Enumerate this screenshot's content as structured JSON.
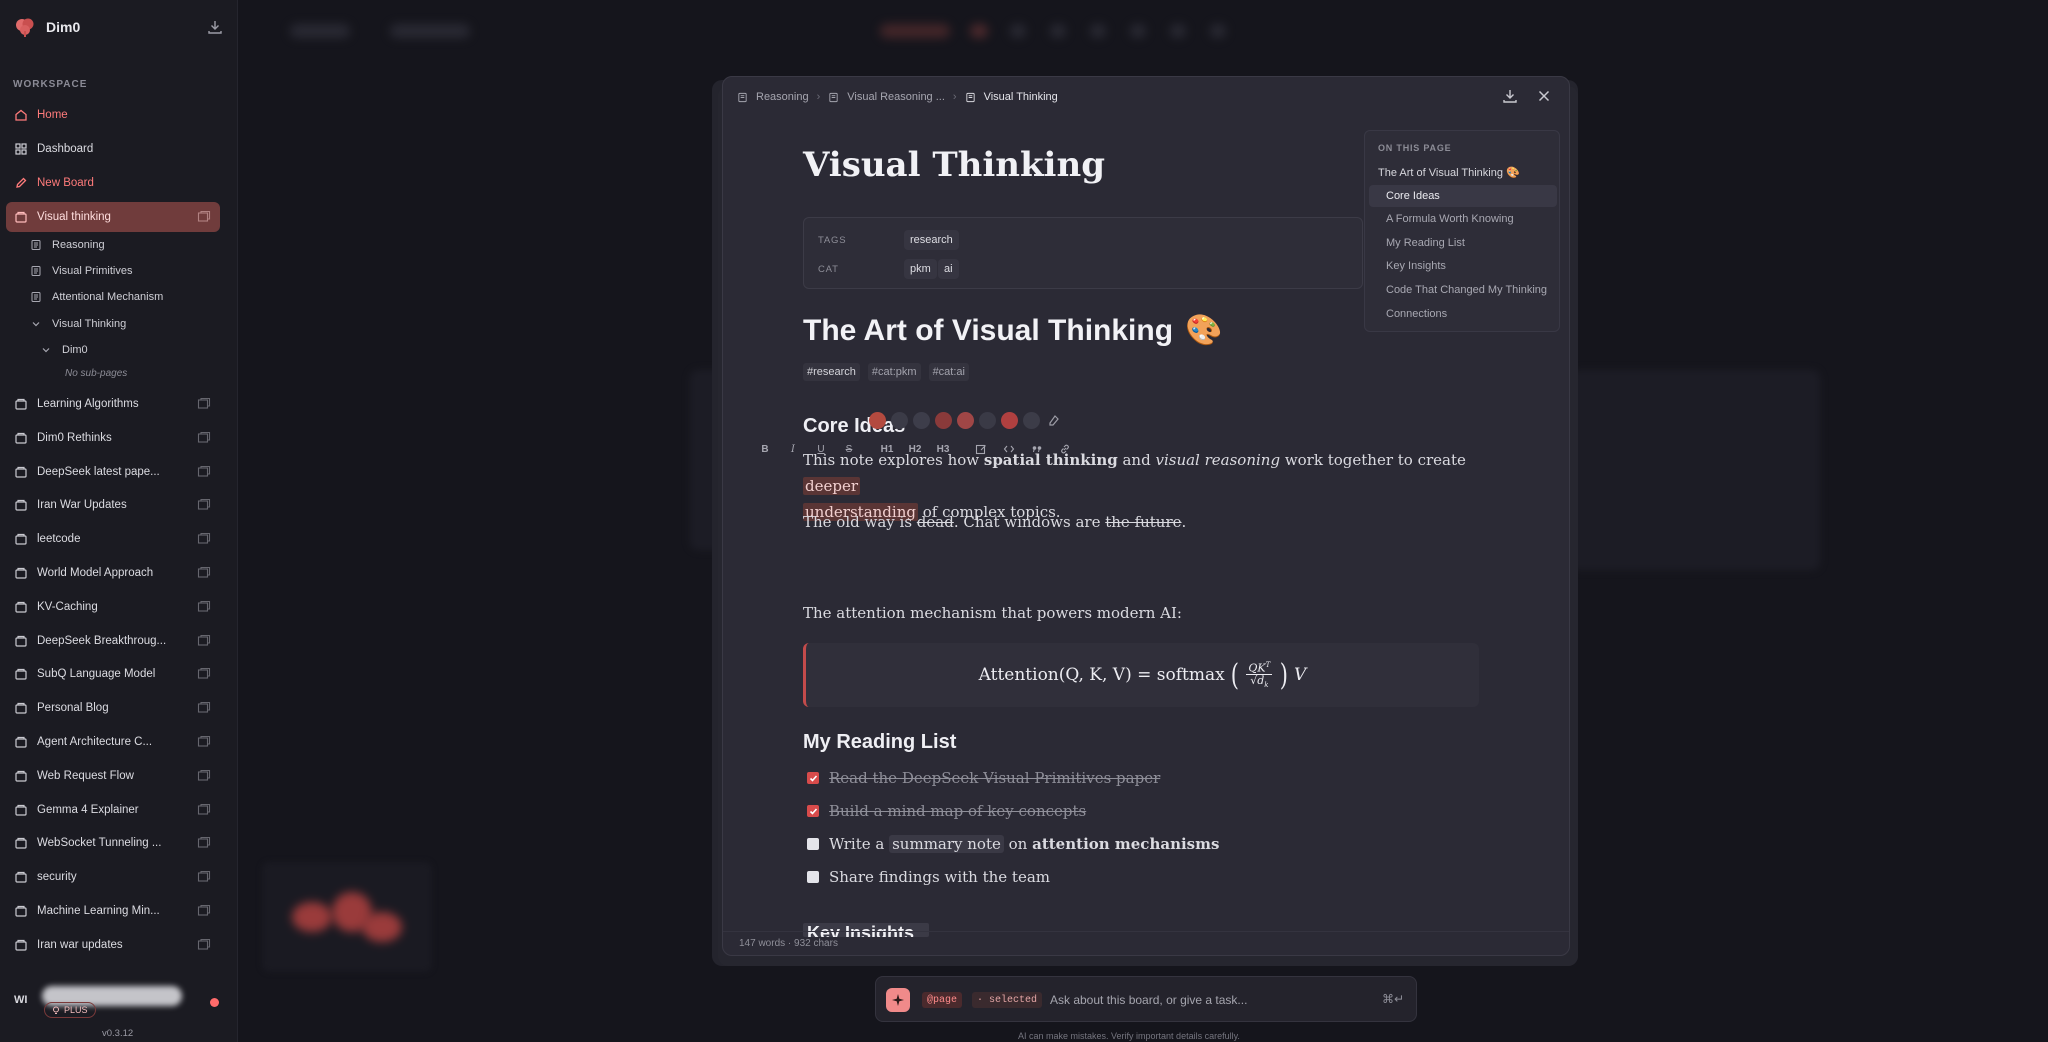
{
  "app": {
    "name": "Dim0",
    "version": "v0.3.12"
  },
  "sidebar": {
    "section_label": "WORKSPACE",
    "top_items": [
      {
        "label": "Home",
        "icon": "home-icon"
      },
      {
        "label": "Dashboard",
        "icon": "grid-icon"
      },
      {
        "label": "New Board",
        "icon": "pencil-icon"
      },
      {
        "label": "Visual thinking",
        "icon": "board-icon"
      }
    ],
    "sub_items": [
      {
        "label": "Reasoning"
      },
      {
        "label": "Visual Primitives"
      },
      {
        "label": "Attentional Mechanism"
      },
      {
        "label": "Visual Thinking"
      },
      {
        "label": "Dim0"
      }
    ],
    "no_subpages": "No sub-pages",
    "boards": [
      "Learning Algorithms",
      "Dim0 Rethinks",
      "DeepSeek latest pape...",
      "Iran War Updates",
      "leetcode",
      "World Model Approach",
      "KV-Caching",
      "DeepSeek Breakthroug...",
      "SubQ Language Model",
      "Personal Blog",
      "Agent Architecture C...",
      "Web Request Flow",
      "Gemma 4 Explainer",
      "WebSocket Tunneling ...",
      "security",
      "Machine Learning Min...",
      "Iran war updates"
    ],
    "user": {
      "initials": "WI",
      "plan": "PLUS"
    }
  },
  "panel": {
    "breadcrumbs": [
      "Reasoning",
      "Visual Reasoning ...",
      "Visual Thinking"
    ],
    "title": "Visual Thinking",
    "props": {
      "tags_label": "TAGS",
      "tags": [
        "research"
      ],
      "cat_label": "CAT",
      "cats": [
        "pkm",
        "ai"
      ]
    },
    "h1": "The Art of Visual Thinking",
    "h1_emoji": "🎨",
    "hashtags": [
      "#research",
      "#cat:pkm",
      "#cat:ai"
    ],
    "core_ideas": {
      "heading": "Core Ideas",
      "p1_a": "This note explores how ",
      "p1_b": "spatial thinking",
      "p1_c": " and ",
      "p1_d": "visual reasoning",
      "p1_e": " work together to create ",
      "p1_f": "deeper",
      "p1_g": "understanding",
      "p1_h": " of complex topics.",
      "p2_a": "The old way is ",
      "p2_b": "dead",
      "p2_c": ". Chat windows are ",
      "p2_d": "the future",
      "p2_e": "."
    },
    "toolbar": [
      "B",
      "I",
      "U",
      "S",
      "H1",
      "H2",
      "H3"
    ],
    "attention_text": "The attention mechanism that powers modern AI:",
    "formula": {
      "lhs": "Attention(Q, K, V) = softmax",
      "num": "QK",
      "sup": "T",
      "den": "√d",
      "den_sub": "k",
      "tail": "V"
    },
    "reading_list": {
      "heading": "My Reading List",
      "items": [
        {
          "text": "Read the DeepSeek Visual Primitives paper",
          "done": true
        },
        {
          "text": "Build a mind map of key concepts",
          "done": true
        },
        {
          "text_a": "Write a ",
          "text_b": "summary note",
          "text_c": " on ",
          "text_d": "attention mechanisms",
          "done": false
        },
        {
          "text": "Share findings with the team",
          "done": false
        }
      ]
    },
    "next_heading": "Key Insights",
    "word_count": "147 words · 932 chars"
  },
  "toc": {
    "title": "ON THIS PAGE",
    "items": [
      "The Art of Visual Thinking 🎨",
      "Core Ideas",
      "A Formula Worth Knowing",
      "My Reading List",
      "Key Insights",
      "Code That Changed My Thinking",
      "Connections"
    ]
  },
  "ask": {
    "chip_page": "@page",
    "chip_selected": "· selected",
    "placeholder": "Ask about this board, or give a task...",
    "shortcut": "⌘↵",
    "disclaimer": "AI can make mistakes. Verify important details carefully."
  },
  "colors": {
    "accent": "#ff6b6b",
    "active_board_bg": "#703c3c",
    "highlight_bg": "#5a3535",
    "swatches": [
      "#b34a3f",
      "#3b3b47",
      "#3d3d4a",
      "#8a3a3a",
      "#a04646",
      "#3a3a46",
      "#b04040",
      "#3c3c48"
    ]
  }
}
